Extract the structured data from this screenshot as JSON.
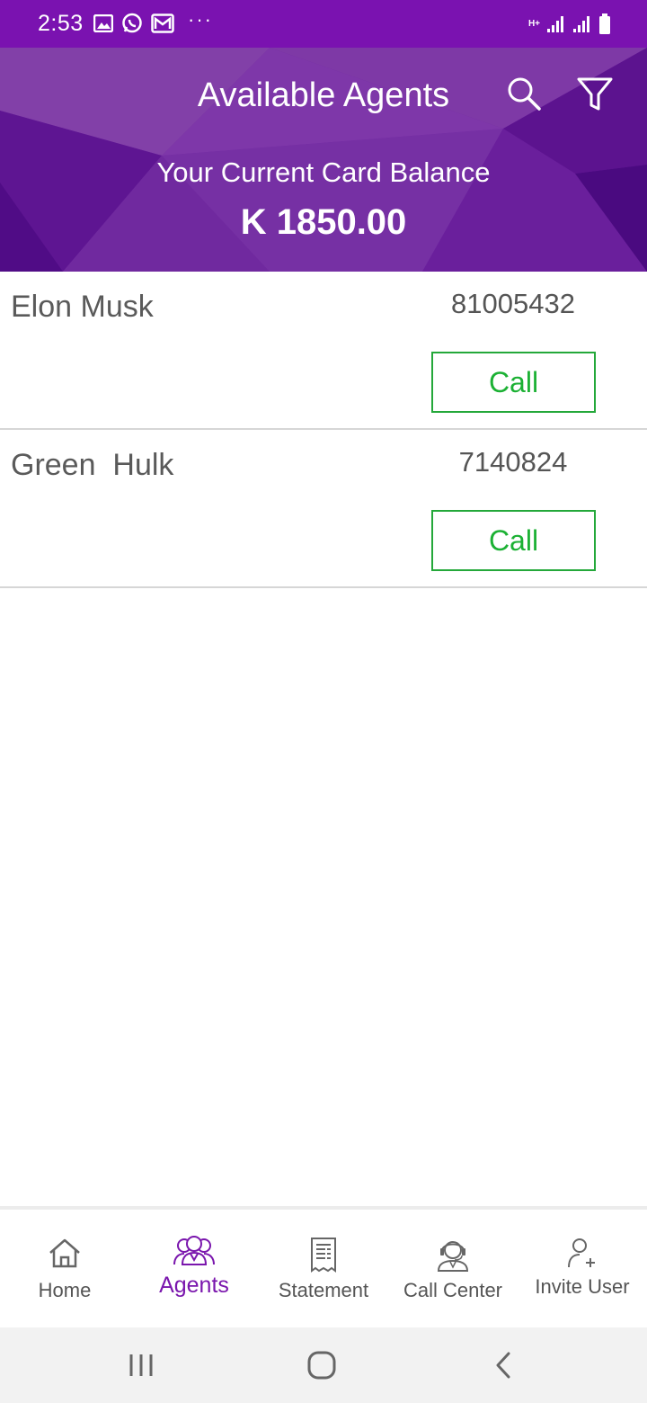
{
  "status_bar": {
    "time": "2:53",
    "left_icons": [
      "image-icon",
      "whatsapp-icon",
      "gmail-icon",
      "more-dots-icon"
    ],
    "more": "···",
    "network": "H+",
    "right_icons": [
      "network-type-icon",
      "signal-icon",
      "signal-icon",
      "battery-icon"
    ]
  },
  "header": {
    "title": "Available Agents",
    "balance_label": "Your Current Card Balance",
    "balance_value": "K 1850.00",
    "icons": [
      "search-icon",
      "filter-icon"
    ]
  },
  "agents": [
    {
      "name": "Elon Musk",
      "number": "81005432",
      "call_label": "Call"
    },
    {
      "name": "Green  Hulk",
      "number": "7140824",
      "call_label": "Call"
    }
  ],
  "bottom_nav": {
    "items": [
      {
        "label": "Home",
        "icon": "home-icon",
        "active": false
      },
      {
        "label": "Agents",
        "icon": "agents-icon",
        "active": true
      },
      {
        "label": "Statement",
        "icon": "statement-icon",
        "active": false
      },
      {
        "label": "Call Center",
        "icon": "headset-icon",
        "active": false
      },
      {
        "label": "Invite User",
        "icon": "add-user-icon",
        "active": false
      }
    ]
  },
  "android_nav": {
    "buttons": [
      "recent-apps-icon",
      "home-button-icon",
      "back-icon"
    ]
  },
  "colors": {
    "status_bar": "#7a12b0",
    "header_base": "#6a1aa0",
    "accent_purple": "#7a16ad",
    "call_green": "#1cb134"
  }
}
